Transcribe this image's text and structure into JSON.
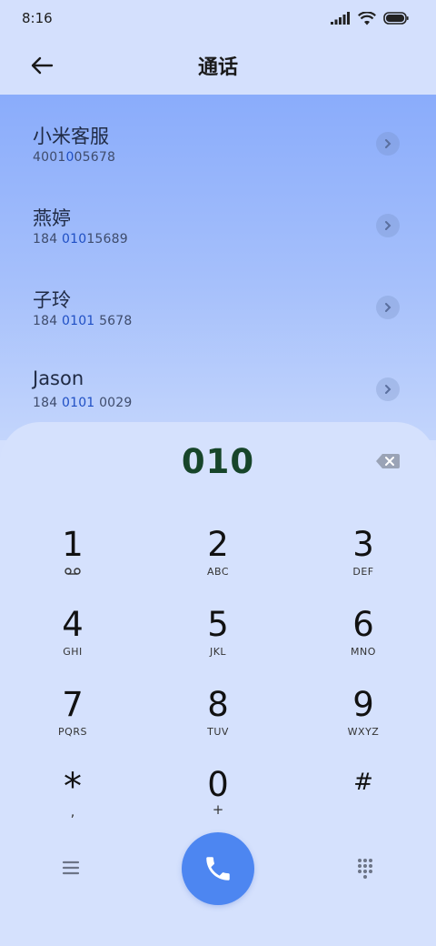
{
  "status": {
    "time": "8:16"
  },
  "header": {
    "title": "通话"
  },
  "contacts": [
    {
      "name": "小米客服",
      "number_pre": "4001",
      "number_hl": "0",
      "number_post": "05678"
    },
    {
      "name": "燕婷",
      "number_pre": "184 ",
      "number_hl": "010",
      "number_post": "15689"
    },
    {
      "name": "子玲",
      "number_pre": "184 ",
      "number_hl": "0101",
      "number_post": " 5678"
    },
    {
      "name": "Jason",
      "number_pre": "184 ",
      "number_hl": "0101",
      "number_post": " 0029"
    }
  ],
  "dialpad": {
    "input": "010",
    "keys": [
      {
        "digit": "1",
        "letters": ""
      },
      {
        "digit": "2",
        "letters": "ABC"
      },
      {
        "digit": "3",
        "letters": "DEF"
      },
      {
        "digit": "4",
        "letters": "GHI"
      },
      {
        "digit": "5",
        "letters": "JKL"
      },
      {
        "digit": "6",
        "letters": "MNO"
      },
      {
        "digit": "7",
        "letters": "PQRS"
      },
      {
        "digit": "8",
        "letters": "TUV"
      },
      {
        "digit": "9",
        "letters": "WXYZ"
      },
      {
        "digit": "*",
        "letters": ","
      },
      {
        "digit": "0",
        "letters": "+"
      },
      {
        "digit": "#",
        "letters": ""
      }
    ]
  },
  "icons": {
    "back": "arrow-left-icon",
    "backspace": "backspace-icon",
    "call": "phone-icon",
    "menu": "menu-icon",
    "keypad": "dialpad-icon"
  },
  "colors": {
    "accent": "#4d86f1",
    "input_text": "#17452a",
    "highlight": "#1f4fc4"
  }
}
